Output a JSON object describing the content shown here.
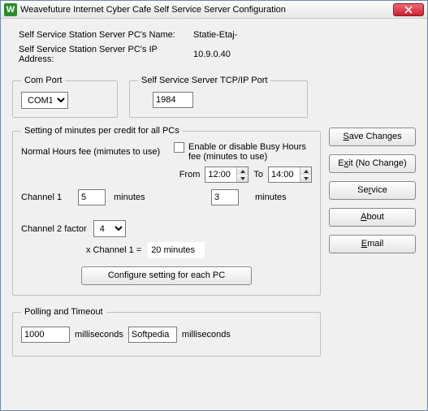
{
  "window": {
    "title": "Weavefuture Internet Cyber Cafe Self Service Server Configuration",
    "icon_letter": "W"
  },
  "info": {
    "name_label": "Self Service Station Server PC's Name:",
    "name_value": "Statie-Etaj-",
    "ip_label": "Self Service Station Server PC's IP Address:",
    "ip_value": "10.9.0.40"
  },
  "comport": {
    "legend": "Com Port",
    "value": "COM1"
  },
  "tcpport": {
    "legend": "Self Service Server TCP/IP Port",
    "value": "1984"
  },
  "settings": {
    "legend": "Setting of minutes per credit for all PCs",
    "normal_label": "Normal Hours fee (mimutes to use)",
    "busy_label": "Enable or disable Busy Hours fee (minutes to use)",
    "from_label": "From",
    "from_value": "12:00",
    "to_label": "To",
    "to_value": "14:00",
    "channel1_label": "Channel  1",
    "channel1_value": "5",
    "minutes_label": "minutes",
    "busy_minutes_value": "3",
    "channel2_label": "Channel  2 factor",
    "channel2_value": "4",
    "xchan_label": "x Channel 1  =",
    "xchan_result": "20 minutes",
    "cfg_button": "Configure setting for each PC"
  },
  "buttons": {
    "save": {
      "u": "S",
      "rest": "ave Changes"
    },
    "exit": {
      "pre": "E",
      "u": "x",
      "rest": "it (No Change)"
    },
    "service": {
      "u": "",
      "rest": "Service",
      "u2": "r",
      "pre2": "Se",
      "post2": "vice"
    },
    "about": {
      "u": "A",
      "rest": "bout"
    },
    "email": {
      "u": "E",
      "rest": "mail"
    }
  },
  "polling": {
    "legend": "Polling and Timeout",
    "value1": "1000",
    "unit": "milliseconds",
    "value2": "Softpedia"
  }
}
